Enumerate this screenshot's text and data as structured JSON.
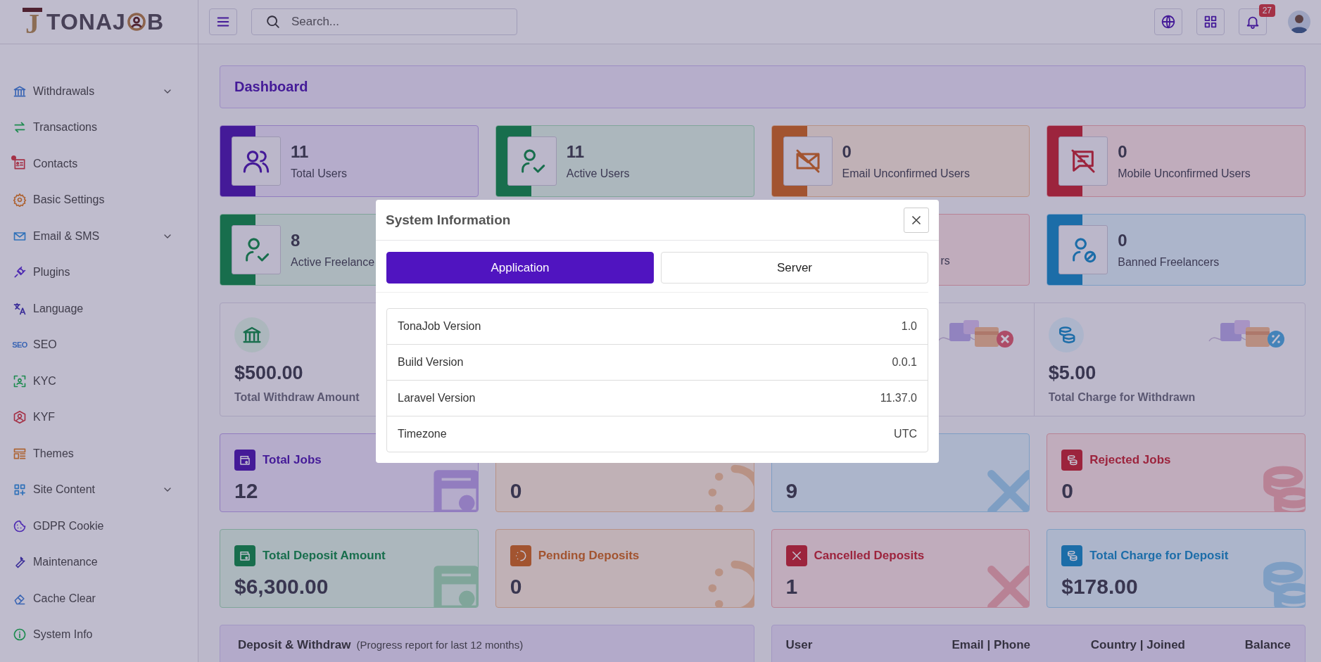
{
  "header": {
    "logo": {
      "mark": "J",
      "wordmark_start": "TONAJ",
      "wordmark_end": "B"
    },
    "search": {
      "placeholder": "Search..."
    },
    "notifications": {
      "count": "27"
    }
  },
  "sidebar": {
    "items": [
      {
        "label": "Withdrawals",
        "expandable": true,
        "has_dot": false
      },
      {
        "label": "Transactions",
        "expandable": false,
        "has_dot": false
      },
      {
        "label": "Contacts",
        "expandable": false,
        "has_dot": true
      },
      {
        "label": "Basic Settings",
        "expandable": false,
        "has_dot": false
      },
      {
        "label": "Email & SMS",
        "expandable": true,
        "has_dot": false
      },
      {
        "label": "Plugins",
        "expandable": false,
        "has_dot": false
      },
      {
        "label": "Language",
        "expandable": false,
        "has_dot": false
      },
      {
        "label": "SEO",
        "expandable": false,
        "has_dot": false,
        "icon_text": "SEO"
      },
      {
        "label": "KYC",
        "expandable": false,
        "has_dot": false
      },
      {
        "label": "KYF",
        "expandable": false,
        "has_dot": false
      },
      {
        "label": "Themes",
        "expandable": false,
        "has_dot": false
      },
      {
        "label": "Site Content",
        "expandable": true,
        "has_dot": false
      },
      {
        "label": "GDPR Cookie",
        "expandable": false,
        "has_dot": false
      },
      {
        "label": "Maintenance",
        "expandable": false,
        "has_dot": false
      },
      {
        "label": "Cache Clear",
        "expandable": false,
        "has_dot": false
      },
      {
        "label": "System Info",
        "expandable": false,
        "has_dot": false
      }
    ]
  },
  "page_title": "Dashboard",
  "user_cards": [
    {
      "kind": "full",
      "value": "11",
      "label": "Total Users"
    },
    {
      "kind": "full",
      "value": "11",
      "label": "Active Users"
    },
    {
      "kind": "full",
      "value": "0",
      "label": "Email Unconfirmed Users"
    },
    {
      "kind": "full",
      "value": "0",
      "label": "Mobile Unconfirmed Users"
    },
    {
      "kind": "full",
      "value": "8",
      "label": "Active Freelance"
    },
    {
      "kind": "covered"
    },
    {
      "kind": "clipped",
      "label": "rs"
    },
    {
      "kind": "full",
      "value": "0",
      "label": "Banned Freelancers"
    }
  ],
  "withdraw_panel": [
    {
      "kind": "stat",
      "value": "$500.00",
      "label": "Total Withdraw Amount"
    },
    {
      "kind": "covered"
    },
    {
      "kind": "decor_cancel"
    },
    {
      "kind": "stat_percent",
      "value": "$5.00",
      "label": "Total Charge for Withdrawn"
    }
  ],
  "job_cards": [
    {
      "title": "Total Jobs",
      "value": "12"
    },
    {
      "value": "0"
    },
    {
      "value": "9"
    },
    {
      "title": "Rejected Jobs",
      "value": "0"
    }
  ],
  "deposit_cards": [
    {
      "title": "Total Deposit Amount",
      "value": "$6,300.00"
    },
    {
      "title": "Pending Deposits",
      "value": "0"
    },
    {
      "title": "Cancelled Deposits",
      "value": "1"
    },
    {
      "title": "Total Charge for Deposit",
      "value": "$178.00"
    }
  ],
  "report": {
    "title": "Deposit & Withdraw",
    "subtitle": "(Progress report for last 12 months)"
  },
  "users_table": {
    "columns": [
      "User",
      "Email | Phone",
      "Country | Joined",
      "Balance"
    ]
  },
  "modal": {
    "title": "System Information",
    "tabs": [
      {
        "label": "Application",
        "selected": true
      },
      {
        "label": "Server",
        "selected": false
      }
    ],
    "rows": [
      {
        "label": "TonaJob Version",
        "value": "1.0"
      },
      {
        "label": "Build Version",
        "value": "0.0.1"
      },
      {
        "label": "Laravel Version",
        "value": "11.37.0"
      },
      {
        "label": "Timezone",
        "value": "UTC"
      }
    ]
  }
}
